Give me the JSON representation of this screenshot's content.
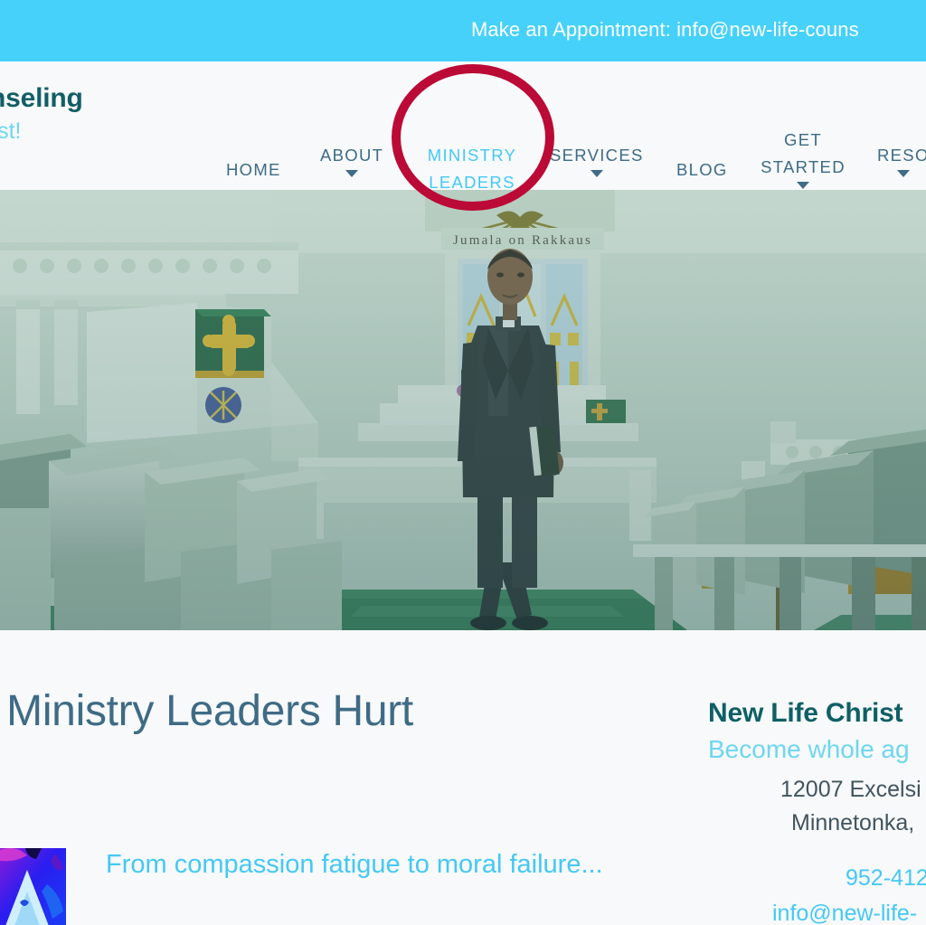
{
  "topbar": {
    "contact_text": "Make an Appointment: info@new-life-couns",
    "background_color": "#45d1fa",
    "text_color": "#ffffff"
  },
  "header": {
    "logo_main": "n Counseling",
    "logo_sub": "n in Christ!",
    "logo_main_color": "#125e66",
    "logo_sub_color": "#6fd6f0",
    "background_color": "#f7f9fa"
  },
  "nav": {
    "text_color": "#3e6b85",
    "active_color": "#45c8f5",
    "items": [
      {
        "label": "HOME",
        "has_caret": false,
        "active": false
      },
      {
        "label": "ABOUT",
        "has_caret": true,
        "active": false
      },
      {
        "label": "MINISTRY LEADERS",
        "has_caret": false,
        "active": true
      },
      {
        "label": "SERVICES",
        "has_caret": true,
        "active": false
      },
      {
        "label": "BLOG",
        "has_caret": false,
        "active": false
      },
      {
        "label": "GET STARTED",
        "has_caret": true,
        "active": false
      },
      {
        "label": "RESO",
        "has_caret": true,
        "active": false
      }
    ]
  },
  "annotation": {
    "target": "MINISTRY LEADERS",
    "shape": "ellipse",
    "color": "#bb0a36",
    "stroke_width_px": 10
  },
  "hero": {
    "alt": "Clergyman standing in church sanctuary aisle holding a Bible",
    "inscription": "Jumala on Rakkaus",
    "caption_color": "#4a4a3c"
  },
  "main": {
    "post_title": "es Ministry Leaders Hurt",
    "post_title_color": "#3e6b85",
    "post_link": "From compassion fatigue to moral failure...",
    "post_link_color": "#45c8f5"
  },
  "sidebar": {
    "title": "New Life Christ",
    "tagline": "Become whole ag",
    "address_line1": "12007 Excelsi",
    "address_line2": "Minnetonka,",
    "phone": "952-412",
    "email": "info@new-life-",
    "title_color": "#0f5f66",
    "tagline_color": "#6fd6f0",
    "address_color": "#41545f",
    "link_color": "#45c8f5"
  }
}
